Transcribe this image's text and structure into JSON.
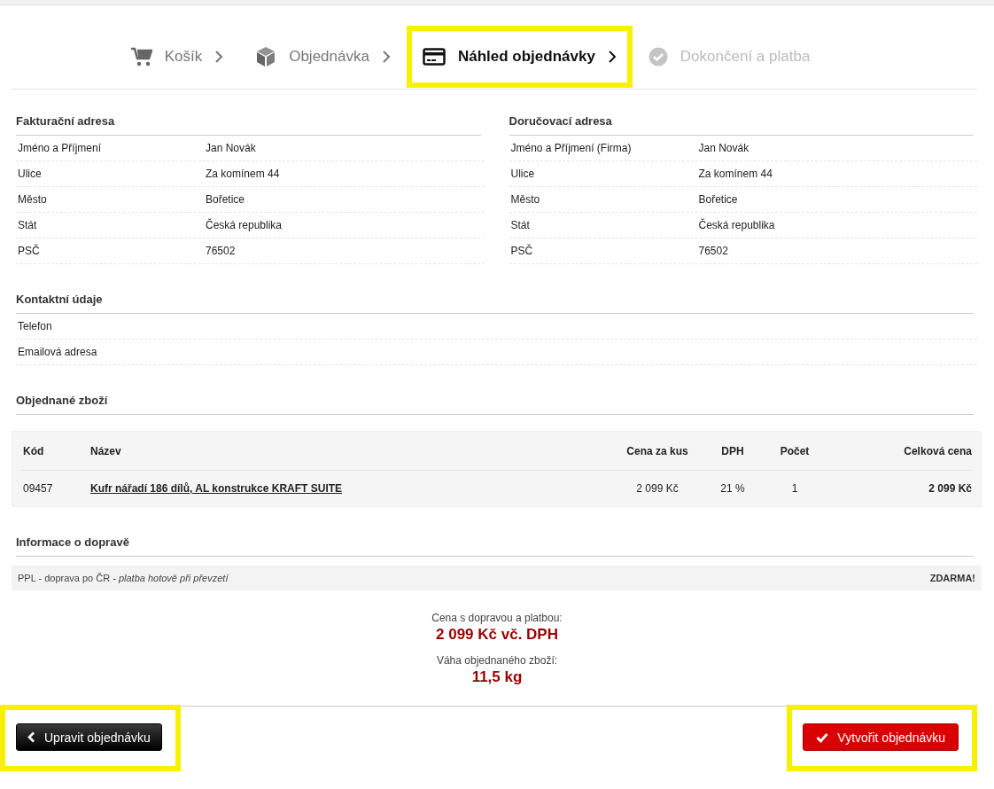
{
  "steps": [
    {
      "label": "Košík",
      "kind": "cart",
      "selected": false,
      "disabled": false
    },
    {
      "label": "Objednávka",
      "kind": "box",
      "selected": false,
      "disabled": false
    },
    {
      "label": "Náhled objednávky",
      "kind": "card",
      "selected": true,
      "disabled": false
    },
    {
      "label": "Dokončení a platba",
      "kind": "check",
      "selected": false,
      "disabled": true
    }
  ],
  "billing": {
    "title": "Fakturační adresa",
    "rows": [
      {
        "label": "Jméno a Příjmení",
        "value": "Jan Novák"
      },
      {
        "label": "Ulice",
        "value": "Za komínem 44"
      },
      {
        "label": "Město",
        "value": "Bořetice"
      },
      {
        "label": "Stát",
        "value": "Česká republika"
      },
      {
        "label": "PSČ",
        "value": "76502"
      }
    ]
  },
  "shipping": {
    "title": "Doručovací adresa",
    "rows": [
      {
        "label": "Jméno a Příjmení (Firma)",
        "value": "Jan Novák"
      },
      {
        "label": "Ulice",
        "value": "Za komínem 44"
      },
      {
        "label": "Město",
        "value": "Bořetice"
      },
      {
        "label": "Stát",
        "value": "Česká republika"
      },
      {
        "label": "PSČ",
        "value": "76502"
      }
    ]
  },
  "contact": {
    "title": "Kontaktní údaje",
    "rows": [
      {
        "label": "Telefon"
      },
      {
        "label": "Emailová adresa"
      }
    ]
  },
  "goods": {
    "title": "Objednané zboží",
    "columns": [
      "Kód",
      "Název",
      "Cena za kus",
      "DPH",
      "Počet",
      "Celková cena"
    ],
    "rows": [
      {
        "code": "09457",
        "name": "Kufr nářadí 186 dílů, AL konstrukce KRAFT SUITE",
        "unit_price": "2 099 Kč",
        "vat": "21 %",
        "qty": "1",
        "total": "2 099 Kč"
      }
    ]
  },
  "delivery": {
    "title": "Informace o dopravě",
    "carrier": "PPL - doprava po ČR",
    "payment": "- platba hotově při převzetí",
    "price": "ZDARMA!"
  },
  "summary": {
    "price_label": "Cena s dopravou a platbou:",
    "price": "2 099 Kč vč. DPH",
    "weight_label": "Váha objednaného zboží:",
    "weight": "11,5 kg"
  },
  "buttons": [
    {
      "kind": "back",
      "label": "Upravit objednávku",
      "highlighted": true
    },
    {
      "kind": "submit",
      "label": "Vytvořit objednávku",
      "highlighted": true
    }
  ]
}
